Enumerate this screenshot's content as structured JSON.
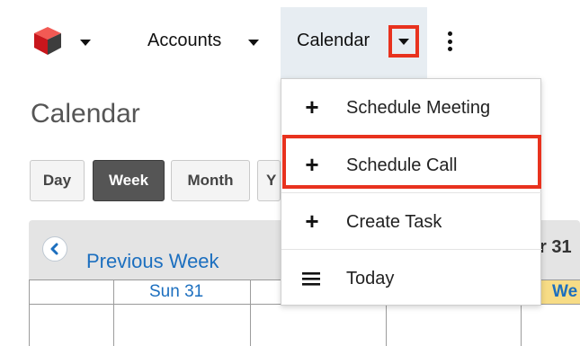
{
  "nav": {
    "accounts_label": "Accounts",
    "calendar_label": "Calendar",
    "accent_highlight": "#e8321e"
  },
  "page": {
    "title": "Calendar"
  },
  "views": {
    "day": "Day",
    "week": "Week",
    "month": "Month",
    "year_partial": "Y"
  },
  "calendar": {
    "previous_week": "Previous Week",
    "date_partial": "r 31",
    "sun_label": "Sun 31",
    "today_partial": "We"
  },
  "menu": {
    "items": [
      {
        "label": "Schedule Meeting",
        "icon": "plus-icon"
      },
      {
        "label": "Schedule Call",
        "icon": "plus-icon"
      },
      {
        "label": "Create Task",
        "icon": "plus-icon"
      },
      {
        "label": "Today",
        "icon": "list-icon"
      }
    ]
  }
}
